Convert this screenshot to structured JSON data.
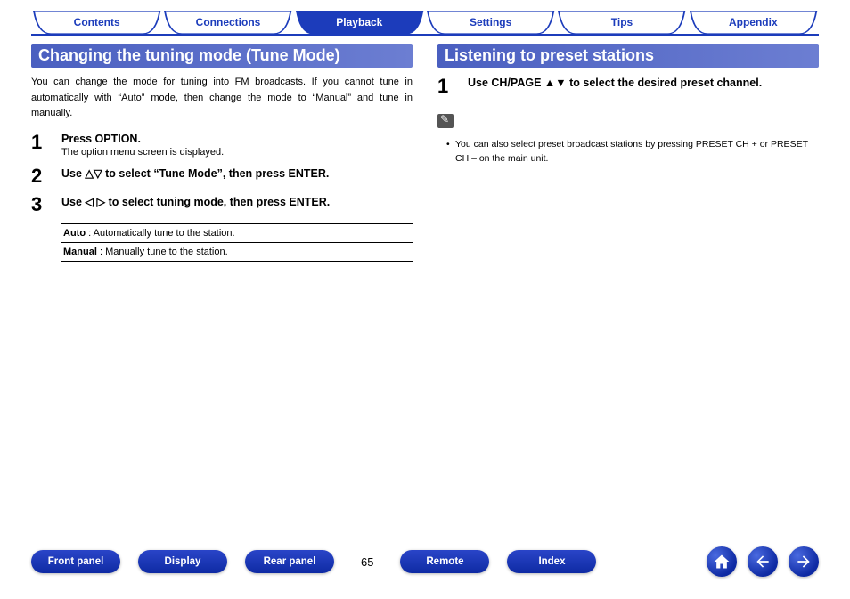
{
  "tabs": [
    "Contents",
    "Connections",
    "Playback",
    "Settings",
    "Tips",
    "Appendix"
  ],
  "active_tab": 2,
  "left": {
    "title": "Changing the tuning mode (Tune Mode)",
    "intro": "You can change the mode for tuning into FM broadcasts. If you cannot tune in automatically with “Auto” mode, then change the mode to “Manual” and tune in manually.",
    "steps": [
      {
        "num": "1",
        "title": "Press OPTION.",
        "desc": "The option menu screen is displayed."
      },
      {
        "num": "2",
        "title_pre": "Use ",
        "title_post": " to select “Tune Mode”, then press ENTER."
      },
      {
        "num": "3",
        "title_pre": "Use ",
        "title_post": " to select tuning mode, then press ENTER."
      }
    ],
    "options": [
      {
        "label": "Auto",
        "desc": " : Automatically tune to the station."
      },
      {
        "label": "Manual",
        "desc": " : Manually tune to the station."
      }
    ]
  },
  "right": {
    "title": "Listening to preset stations",
    "step": {
      "num": "1",
      "pre": "Use CH/PAGE ",
      "post": " to select the desired preset channel."
    },
    "note": "You can also select preset broadcast stations by pressing PRESET CH + or PRESET CH – on the main unit."
  },
  "footer": {
    "buttons": [
      "Front panel",
      "Display",
      "Rear panel"
    ],
    "page": "65",
    "buttons2": [
      "Remote",
      "Index"
    ]
  }
}
